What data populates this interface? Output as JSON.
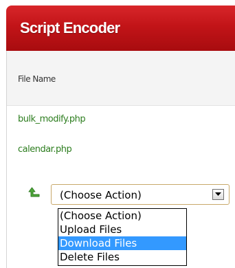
{
  "header": {
    "title": "Script Encoder"
  },
  "table": {
    "column_header": "File Name",
    "files": [
      "bulk_modify.php",
      "calendar.php"
    ]
  },
  "action_select": {
    "value": "(Choose Action)",
    "options": [
      "(Choose Action)",
      "Upload Files",
      "Download Files",
      "Delete Files"
    ],
    "highlighted": "Download Files"
  },
  "icons": {
    "back_arrow": "curved-up-left-arrow-icon",
    "dropdown": "chevron-down-icon"
  },
  "colors": {
    "header_red": "#c21418",
    "link_green": "#2c7d1e",
    "highlight_blue": "#3399ff"
  }
}
